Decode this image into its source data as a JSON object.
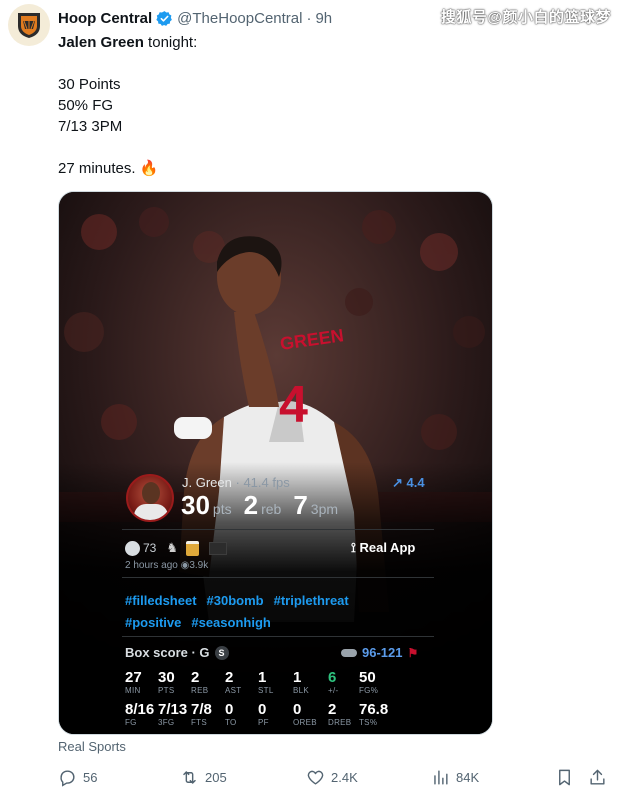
{
  "tweet": {
    "author_name": "Hoop Central",
    "handle": "@TheHoopCentral",
    "time": "9h",
    "text_lines": {
      "l1_bold": "Jalen Green",
      "l1_rest": " tonight:",
      "l2": "30 Points",
      "l3": "50% FG",
      "l4": "7/13 3PM",
      "l5": "27 minutes. 🔥"
    },
    "source": "Real Sports"
  },
  "watermark": "搜狐号@颜小白的篮球梦",
  "card": {
    "jersey_name": "GREEN",
    "jersey_number": "4",
    "player_label": "J. Green",
    "fps": "41.4 fps",
    "trend": "4.4",
    "stats": [
      {
        "value": "30",
        "unit": "pts"
      },
      {
        "value": "2",
        "unit": "reb"
      },
      {
        "value": "7",
        "unit": "3pm"
      }
    ],
    "reactions": {
      "count": "73"
    },
    "real_app": "Real App",
    "posted": "2 hours ago",
    "views": "3.9k",
    "hashtags": [
      "#filledsheet",
      "#30bomb",
      "#triplethreat",
      "#positive",
      "#seasonhigh"
    ],
    "box_title": "Box score · G",
    "box_badge": "S",
    "score": "96-121",
    "box_row1": [
      {
        "v": "27",
        "l": "MIN"
      },
      {
        "v": "30",
        "l": "PTS"
      },
      {
        "v": "2",
        "l": "REB"
      },
      {
        "v": "2",
        "l": "AST"
      },
      {
        "v": "1",
        "l": "STL"
      },
      {
        "v": "1",
        "l": "BLK"
      },
      {
        "v": "6",
        "l": "+/-"
      },
      {
        "v": "50",
        "l": "FG%"
      }
    ],
    "box_row2": [
      {
        "v": "8/16",
        "l": "FG"
      },
      {
        "v": "7/13",
        "l": "3FG"
      },
      {
        "v": "7/8",
        "l": "FTS"
      },
      {
        "v": "0",
        "l": "TO"
      },
      {
        "v": "0",
        "l": "PF"
      },
      {
        "v": "0",
        "l": "OREB"
      },
      {
        "v": "2",
        "l": "DREB"
      },
      {
        "v": "76.8",
        "l": "TS%"
      }
    ]
  },
  "actions": {
    "replies": "56",
    "retweets": "205",
    "likes": "2.4K",
    "views": "84K"
  }
}
